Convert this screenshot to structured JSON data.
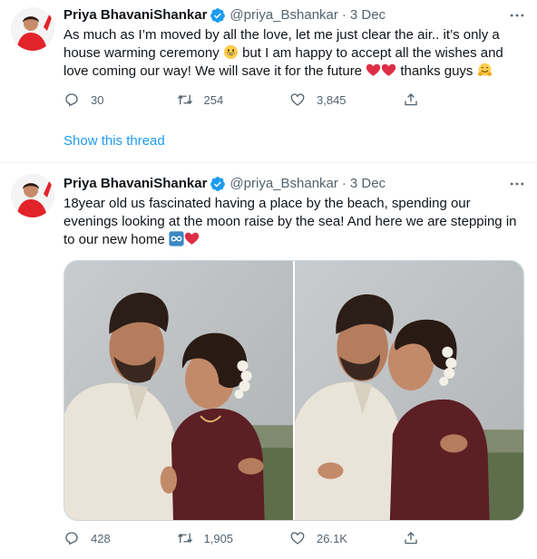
{
  "tweets": [
    {
      "author": {
        "name": "Priya BhavaniShankar",
        "handle": "@priya_Bshankar",
        "date": "3 Dec",
        "avatar_icon": "profile-avatar"
      },
      "text_lines": [
        "As much as I’m moved by all the love, let me just clear the air.. it’s only a",
        "house warming ceremony",
        "but I am happy to accept all the wishes and",
        "love coming our way! We will save it for the future",
        "thanks guys"
      ],
      "actions": {
        "replies": "30",
        "retweets": "254",
        "likes": "3,845"
      },
      "show_thread": "Show this thread"
    },
    {
      "author": {
        "name": "Priya BhavaniShankar",
        "handle": "@priya_Bshankar",
        "date": "3 Dec",
        "avatar_icon": "profile-avatar"
      },
      "text_lines": [
        "18year old us fascinated having a place by the beach, spending our",
        "evenings looking at the moon raise by the sea! And here we are stepping in",
        "to our new home"
      ],
      "media": [
        {
          "icon": "couple-photo-forehead-kiss"
        },
        {
          "icon": "couple-photo-cheek-kiss"
        }
      ],
      "actions": {
        "replies": "428",
        "retweets": "1,905",
        "likes": "26.1K"
      }
    }
  ],
  "colors": {
    "accent": "#1d9bf0",
    "secondary_text": "#536471",
    "heart": "#e0245e",
    "verified": "#1d9bf0"
  }
}
